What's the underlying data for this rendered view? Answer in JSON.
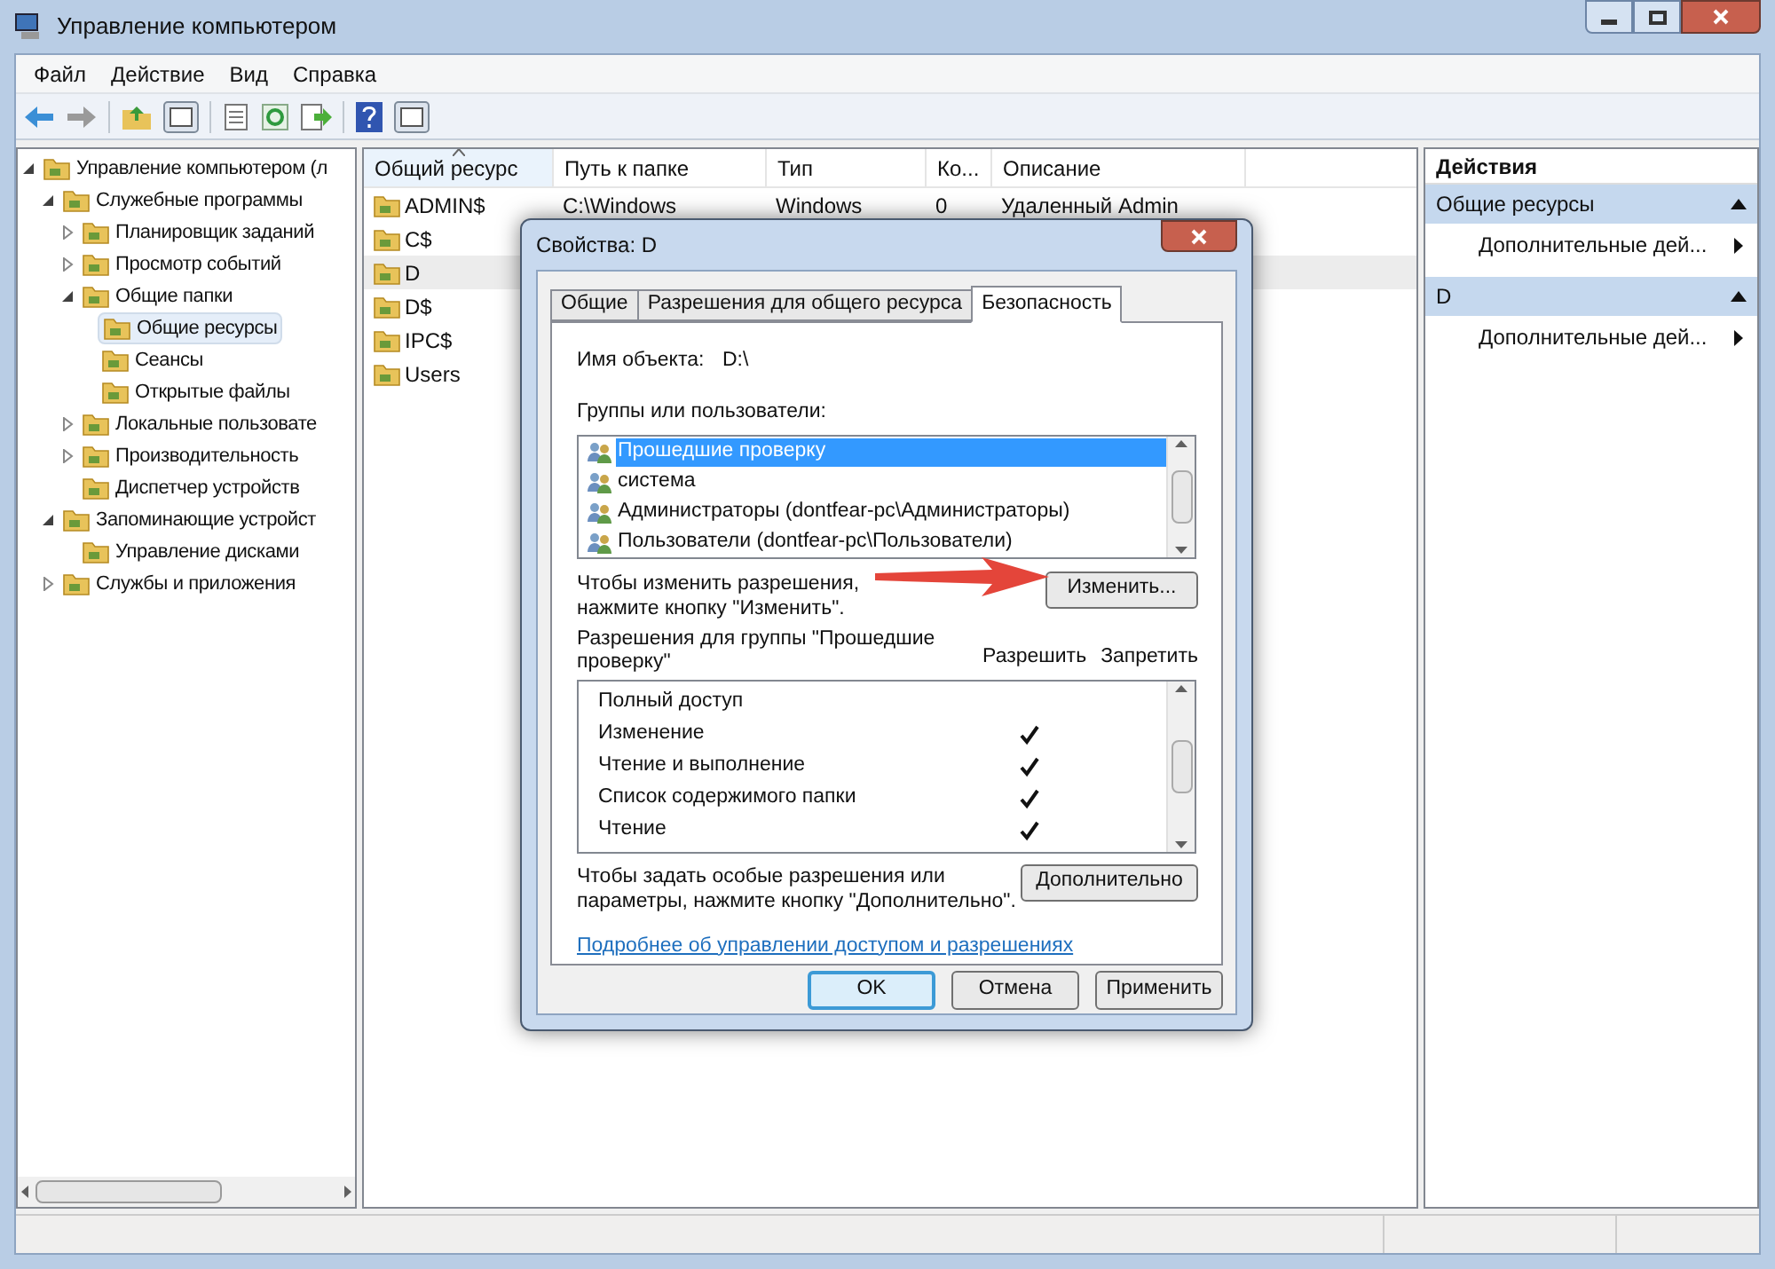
{
  "window": {
    "title": "Управление компьютером"
  },
  "menu": [
    "Файл",
    "Действие",
    "Вид",
    "Справка"
  ],
  "tree": [
    {
      "label": "Управление компьютером (л",
      "selected": false,
      "expanded": true,
      "children": [
        {
          "label": "Служебные программы",
          "selected": false,
          "expanded": true,
          "children": [
            {
              "label": "Планировщик заданий",
              "selected": false,
              "expanded": false
            },
            {
              "label": "Просмотр событий",
              "selected": false,
              "expanded": false
            },
            {
              "label": "Общие папки",
              "selected": false,
              "expanded": true,
              "children": [
                {
                  "label": "Общие ресурсы",
                  "selected": true
                },
                {
                  "label": "Сеансы",
                  "selected": false
                },
                {
                  "label": "Открытые файлы",
                  "selected": false
                }
              ]
            },
            {
              "label": "Локальные пользовате",
              "selected": false,
              "expanded": false
            },
            {
              "label": "Производительность",
              "selected": false,
              "expanded": false
            },
            {
              "label": "Диспетчер устройств",
              "selected": false
            }
          ]
        },
        {
          "label": "Запоминающие устройст",
          "selected": false,
          "expanded": true,
          "children": [
            {
              "label": "Управление дисками",
              "selected": false
            }
          ]
        },
        {
          "label": "Службы и приложения",
          "selected": false,
          "expanded": false
        }
      ]
    }
  ],
  "shares": {
    "columns": [
      {
        "label": "Общий ресурс",
        "sorted": true
      },
      {
        "label": "Путь к папке",
        "sorted": false
      },
      {
        "label": "Тип",
        "sorted": false
      },
      {
        "label": "Ко...",
        "sorted": false
      },
      {
        "label": "Описание",
        "sorted": false
      }
    ],
    "rows": [
      {
        "cells": [
          "ADMIN$",
          "C:\\Windows",
          "Windows",
          "0",
          "Удаленный Admin"
        ],
        "selected": false
      },
      {
        "cells": [
          "C$"
        ],
        "selected": false
      },
      {
        "cells": [
          "D"
        ],
        "selected": true
      },
      {
        "cells": [
          "D$"
        ],
        "selected": false
      },
      {
        "cells": [
          "IPC$"
        ],
        "selected": false
      },
      {
        "cells": [
          "Users"
        ],
        "selected": false
      }
    ]
  },
  "actions": {
    "title": "Действия",
    "sections": [
      {
        "title": "Общие ресурсы",
        "expanded": true,
        "items": [
          "Дополнительные дей..."
        ]
      },
      {
        "title": "D",
        "expanded": true,
        "items": [
          "Дополнительные дей..."
        ]
      }
    ]
  },
  "dialog": {
    "title": "Свойства: D",
    "tabs": [
      {
        "label": "Общие",
        "selected": false
      },
      {
        "label": "Разрешения для общего ресурса",
        "selected": false
      },
      {
        "label": "Безопасность",
        "selected": true
      }
    ],
    "object_label": "Имя объекта:",
    "object_value": "D:\\",
    "groups_label": "Группы или пользователи:",
    "groups": [
      {
        "name": "Прошедшие проверку",
        "selected": true
      },
      {
        "name": "система",
        "selected": false
      },
      {
        "name": "Администраторы (dontfear-pc\\Администраторы)",
        "selected": false
      },
      {
        "name": "Пользователи (dontfear-pc\\Пользователи)",
        "selected": false
      }
    ],
    "change_hint": "Чтобы изменить разрешения, нажмите кнопку \"Изменить\".",
    "change_button": "Изменить...",
    "permissions_label": "Разрешения для группы \"Прошедшие проверку\"",
    "allow_label": "Разрешить",
    "deny_label": "Запретить",
    "permissions": [
      {
        "name": "Полный доступ",
        "allow": false,
        "deny": false
      },
      {
        "name": "Изменение",
        "allow": true,
        "deny": false
      },
      {
        "name": "Чтение и выполнение",
        "allow": true,
        "deny": false
      },
      {
        "name": "Список содержимого папки",
        "allow": true,
        "deny": false
      },
      {
        "name": "Чтение",
        "allow": true,
        "deny": false
      }
    ],
    "advanced_hint": "Чтобы задать особые разрешения или параметры, нажмите кнопку \"Дополнительно\".",
    "advanced_button": "Дополнительно",
    "link": "Подробнее об управлении доступом и разрешениях",
    "buttons": [
      {
        "label": "OK",
        "default": true
      },
      {
        "label": "Отмена",
        "default": false
      },
      {
        "label": "Применить",
        "default": false
      }
    ]
  }
}
